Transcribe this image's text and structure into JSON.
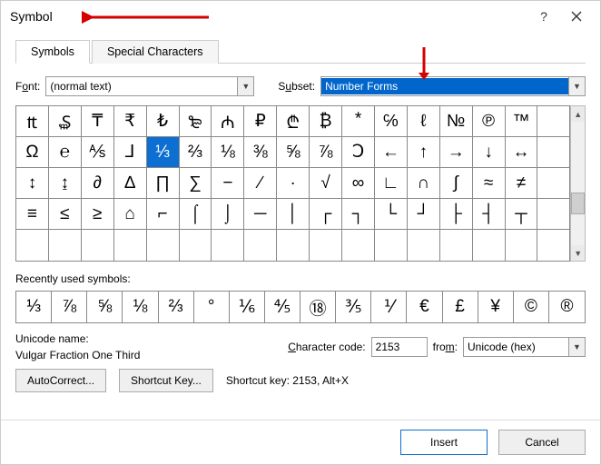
{
  "title": "Symbol",
  "tabs": {
    "symbols": "Symbols",
    "special": "Special Characters"
  },
  "font": {
    "label_pre": "F",
    "label_ul": "o",
    "label_post": "nt:",
    "value": "(normal text)"
  },
  "subset": {
    "label_pre": "S",
    "label_ul": "u",
    "label_post": "bset:",
    "value": "Number Forms"
  },
  "grid": [
    "₶",
    "₷",
    "₸",
    "₹",
    "₺",
    "₻",
    "₼",
    "₽",
    "₾",
    "₿",
    "⃰",
    "℅",
    "ℓ",
    "№",
    "℗",
    "™",
    "",
    "Ω",
    "℮",
    "⅍",
    "⅃",
    "⅓",
    "⅔",
    "⅛",
    "⅜",
    "⅝",
    "⅞",
    "Ↄ",
    "←",
    "↑",
    "→",
    "↓",
    "↔",
    "",
    "↕",
    "↨",
    "∂",
    "∆",
    "∏",
    "∑",
    "−",
    "∕",
    "∙",
    "√",
    "∞",
    "∟",
    "∩",
    "∫",
    "≈",
    "≠",
    "",
    "≡",
    "≤",
    "≥",
    "⌂",
    "⌐",
    "⌠",
    "⌡",
    "─",
    "│",
    "┌",
    "┐",
    "└",
    "┘",
    "├",
    "┤",
    "┬",
    "",
    "",
    "",
    "",
    "",
    "",
    "",
    "",
    "",
    "",
    "",
    "",
    "",
    "",
    "",
    "",
    "",
    ""
  ],
  "grid_selected_index": 21,
  "recent_label": "Recently used symbols:",
  "recent_label_ul_idx": 0,
  "recent": [
    "⅓",
    "⅞",
    "⅝",
    "⅛",
    "⅔",
    "°",
    "⅙",
    "⅘",
    "⑱",
    "⅗",
    "⅟",
    "€",
    "£",
    "¥",
    "©",
    "®"
  ],
  "unicode_name_label": "Unicode name:",
  "unicode_name": "Vulgar Fraction One Third",
  "char_code": {
    "label_pre": "",
    "label_ul": "C",
    "label_post": "haracter code:",
    "value": "2153"
  },
  "from": {
    "label_pre": "fro",
    "label_ul": "m",
    "label_post": ":",
    "value": "Unicode (hex)"
  },
  "autocorrect": "AutoCorrect...",
  "shortcut_btn": "Shortcut Key...",
  "shortcut_text": "Shortcut key: 2153, Alt+X",
  "insert": "Insert",
  "cancel": "Cancel"
}
